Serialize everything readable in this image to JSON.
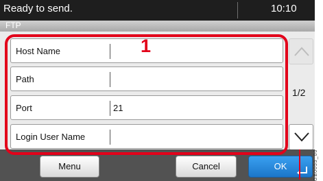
{
  "status_bar": {
    "message": "Ready to send.",
    "time": "10:10"
  },
  "title_bar": {
    "title": "FTP"
  },
  "callout": {
    "number": "1",
    "color": "#e2001a"
  },
  "fields": [
    {
      "label": "Host Name",
      "value": ""
    },
    {
      "label": "Path",
      "value": ""
    },
    {
      "label": "Port",
      "value": "21"
    },
    {
      "label": "Login User Name",
      "value": ""
    }
  ],
  "pagination": {
    "indicator": "1/2",
    "up_icon": "chevron-up-icon",
    "down_icon": "chevron-down-icon"
  },
  "buttons": {
    "menu": "Menu",
    "cancel": "Cancel",
    "ok": "OK"
  },
  "side_code": "GB0055_00",
  "colors": {
    "ok_blue": "#1c76c9",
    "status_dark": "#1e1e1e",
    "bottom_bar": "#525252"
  }
}
